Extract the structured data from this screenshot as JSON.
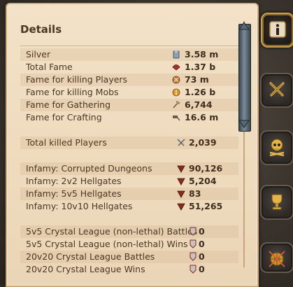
{
  "panel": {
    "title": "Details",
    "rows": [
      {
        "label": "Silver",
        "value": "3.58 m",
        "icon": "silver-coin-icon"
      },
      {
        "label": "Total Fame",
        "value": "1.37 b",
        "icon": "fame-icon"
      },
      {
        "label": "Fame for killing Players",
        "value": "73 m",
        "icon": "fame-pvp-icon"
      },
      {
        "label": "Fame for killing Mobs",
        "value": "1.26 b",
        "icon": "fame-pve-icon"
      },
      {
        "label": "Fame for Gathering",
        "value": "6,744",
        "icon": "fame-gathering-icon"
      },
      {
        "label": "Fame for Crafting",
        "value": "16.6 m",
        "icon": "fame-crafting-icon"
      }
    ],
    "total_killed": {
      "label": "Total killed Players",
      "value": "2,039",
      "icon": "crossed-swords-icon"
    },
    "infamy": [
      {
        "label": "Infamy: Corrupted Dungeons",
        "value": "90,126"
      },
      {
        "label": "Infamy: 2v2 Hellgates",
        "value": "5,204"
      },
      {
        "label": "Infamy: 5v5 Hellgates",
        "value": "83"
      },
      {
        "label": "Infamy: 10v10 Hellgates",
        "value": "51,265"
      }
    ],
    "league": [
      {
        "label": "5v5 Crystal League (non-lethal) Battles",
        "value": "0"
      },
      {
        "label": "5v5 Crystal League (non-lethal) Wins",
        "value": "0"
      },
      {
        "label": "20v20 Crystal League Battles",
        "value": "0"
      },
      {
        "label": "20v20 Crystal League Wins",
        "value": "0"
      }
    ]
  },
  "tabs": [
    {
      "name": "details",
      "icon": "info-icon",
      "active": true
    },
    {
      "name": "combat",
      "icon": "crossed-swords-icon",
      "active": false
    },
    {
      "name": "pvp",
      "icon": "skull-crossbones-icon",
      "active": false
    },
    {
      "name": "achievements",
      "icon": "trophy-icon",
      "active": false
    },
    {
      "name": "guild",
      "icon": "globe-swords-icon",
      "active": false
    }
  ],
  "colors": {
    "parchment": "#f0dec3",
    "text": "#4b3725",
    "accent_gold": "#c8a04a",
    "infamy_red": "#8b2a1f"
  }
}
